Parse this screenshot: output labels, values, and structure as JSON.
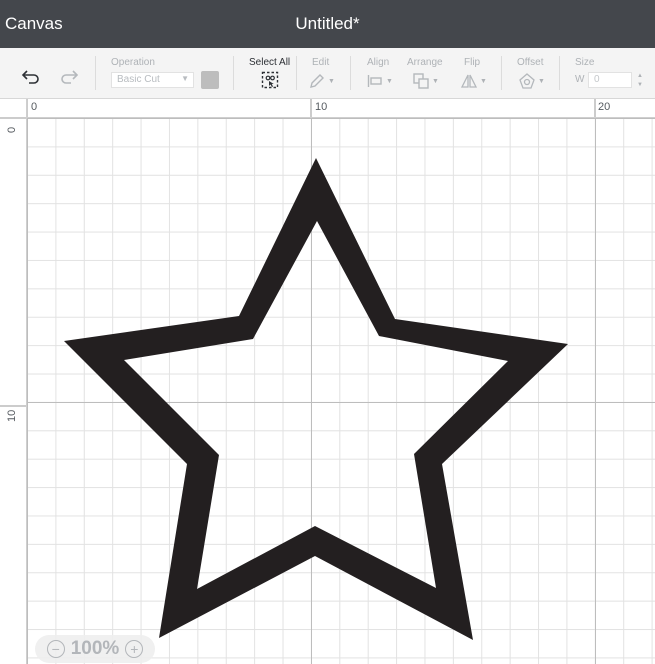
{
  "titlebar": {
    "app_name": "Canvas",
    "document_title": "Untitled*"
  },
  "toolbar": {
    "undo_icon": "undo-icon",
    "redo_icon": "redo-icon",
    "operation": {
      "label": "Operation",
      "value": "Basic Cut",
      "swatch_color": "#bdbdbd"
    },
    "select_all": {
      "label": "Select All"
    },
    "edit": {
      "label": "Edit"
    },
    "align": {
      "label": "Align"
    },
    "arrange": {
      "label": "Arrange"
    },
    "flip": {
      "label": "Flip"
    },
    "offset": {
      "label": "Offset"
    },
    "size": {
      "label": "Size",
      "w_label": "W",
      "w_value": "0"
    }
  },
  "rulers": {
    "top": [
      "0",
      "10",
      "20"
    ],
    "left": [
      "0",
      "10"
    ]
  },
  "canvas": {
    "shape": "star-outline",
    "shape_color": "#231f20"
  },
  "zoom": {
    "value": "100%"
  }
}
